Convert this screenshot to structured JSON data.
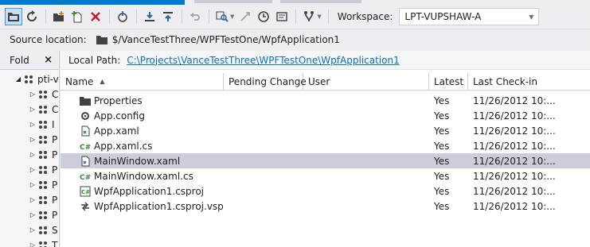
{
  "toolbar": {
    "workspace_label": "Workspace:",
    "workspace_value": "LPT-VUPSHAW-A",
    "buttons": [
      "folders-icon",
      "refresh-icon",
      "new-folder-icon",
      "add-items-icon",
      "delete-icon",
      "compare-icon",
      "get-latest-icon",
      "check-in-icon",
      "undo-icon",
      "find-icon",
      "history-icon",
      "history-icon",
      "branch-icon"
    ]
  },
  "source": {
    "label": "Source location:",
    "path": "$/VanceTestThree/WPFTestOne/WpfApplication1"
  },
  "folders": {
    "title": "Fold",
    "close": "×",
    "items": [
      {
        "label": "pti-v",
        "expanded": true
      },
      {
        "label": "C"
      },
      {
        "label": "C"
      },
      {
        "label": "I"
      },
      {
        "label": "P"
      },
      {
        "label": "P"
      },
      {
        "label": "P"
      },
      {
        "label": "P"
      },
      {
        "label": "P"
      },
      {
        "label": "P"
      },
      {
        "label": "S"
      },
      {
        "label": "T"
      }
    ]
  },
  "local_path": {
    "label": "Local Path:",
    "value": "C:\\Projects\\VanceTestThree\\WPFTestOne\\WpfApplication1"
  },
  "table": {
    "columns": [
      "Name",
      "Pending Change",
      "User",
      "Latest",
      "Last Check-in"
    ],
    "rows": [
      {
        "icon": "folder-icon",
        "name": "Properties",
        "pending": "",
        "user": "",
        "latest": "Yes",
        "checkin": "11/26/2012 10:..."
      },
      {
        "icon": "config-file-icon",
        "name": "App.config",
        "pending": "",
        "user": "",
        "latest": "Yes",
        "checkin": "11/26/2012 10:..."
      },
      {
        "icon": "xaml-file-icon",
        "name": "App.xaml",
        "pending": "",
        "user": "",
        "latest": "Yes",
        "checkin": "11/26/2012 10:..."
      },
      {
        "icon": "csharp-file-icon",
        "name": "App.xaml.cs",
        "pending": "",
        "user": "",
        "latest": "Yes",
        "checkin": "11/26/2012 10:..."
      },
      {
        "icon": "xaml-file-icon",
        "name": "MainWindow.xaml",
        "pending": "",
        "user": "",
        "latest": "Yes",
        "checkin": "11/26/2012 10:...",
        "selected": true
      },
      {
        "icon": "csharp-file-icon",
        "name": "MainWindow.xaml.cs",
        "pending": "",
        "user": "",
        "latest": "Yes",
        "checkin": "11/26/2012 10:..."
      },
      {
        "icon": "csproj-file-icon",
        "name": "WpfApplication1.csproj",
        "pending": "",
        "user": "",
        "latest": "Yes",
        "checkin": "11/26/2012 10:..."
      },
      {
        "icon": "vspscc-file-icon",
        "name": "WpfApplication1.csproj.vsp...",
        "pending": "",
        "user": "",
        "latest": "Yes",
        "checkin": "11/26/2012 10:..."
      }
    ]
  },
  "colors": {
    "accent": "#007acc",
    "selection": "#cbcdda",
    "link": "#0e70c0",
    "chrome": "#eeeef2"
  }
}
